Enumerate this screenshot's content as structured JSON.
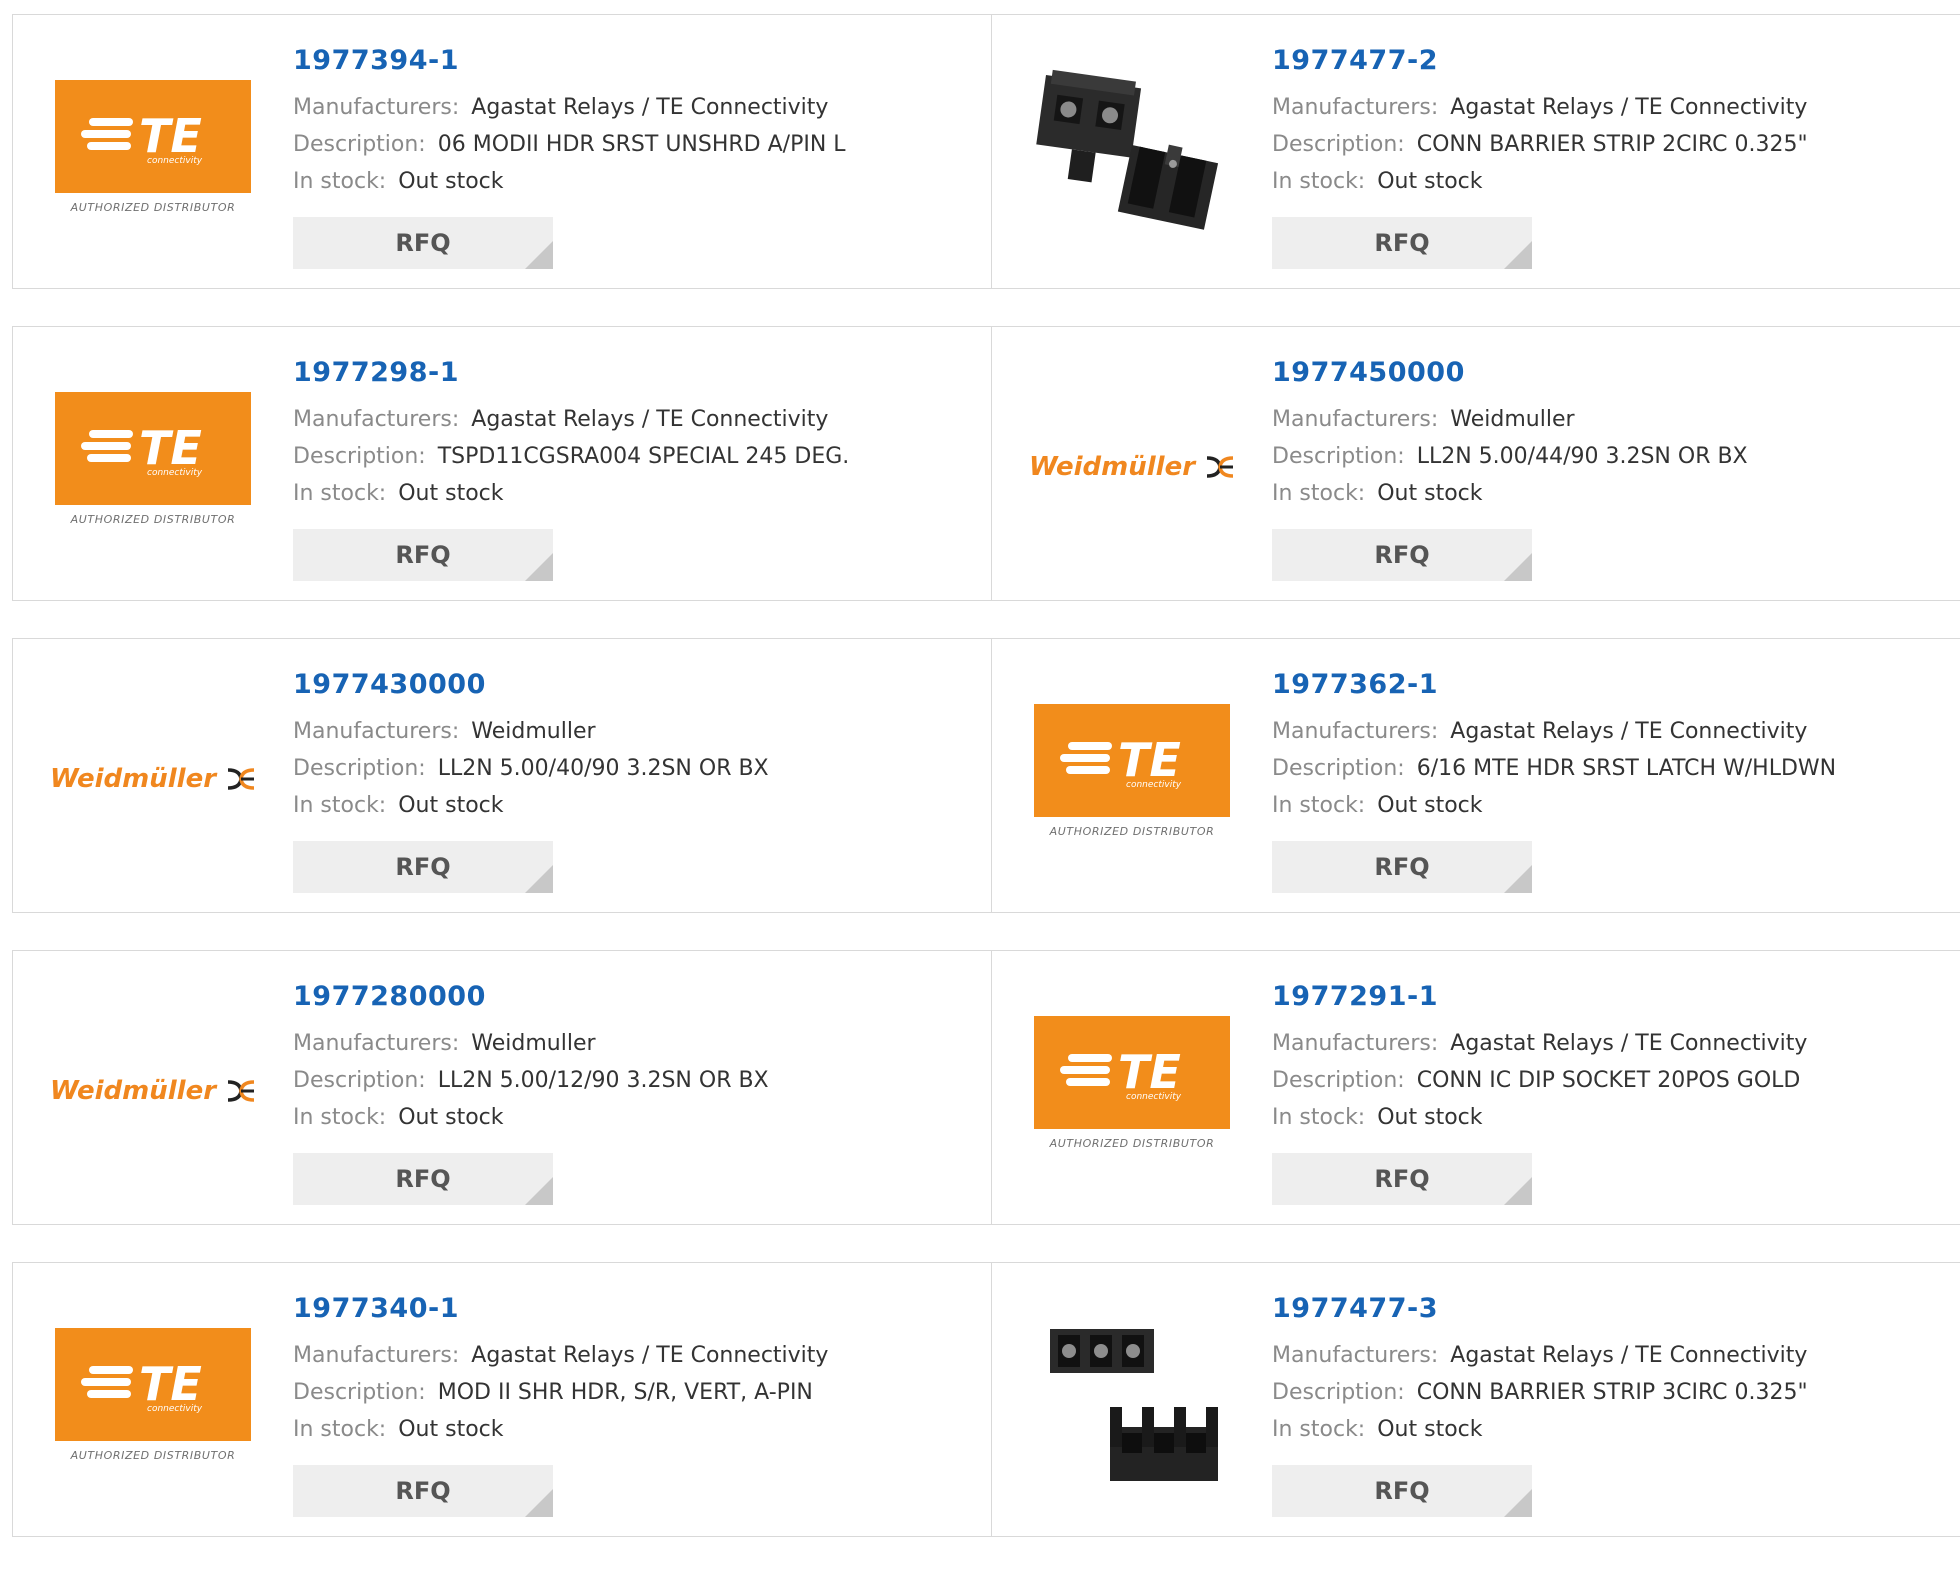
{
  "labels": {
    "manufacturers": "Manufacturers:",
    "description": "Description:",
    "in_stock": "In stock:",
    "rfq": "RFQ"
  },
  "logos": {
    "te_connectivity": "connectivity",
    "te_authorized": "AUTHORIZED DISTRIBUTOR",
    "weidmuller": "Weidmüller"
  },
  "colors": {
    "part_number": "#1763b4",
    "te_orange": "#f28d1b",
    "weidmuller_orange": "#f0871f"
  },
  "products": [
    {
      "part_number": "1977394-1",
      "manufacturer": "Agastat Relays / TE Connectivity",
      "description": "06 MODII HDR SRST UNSHRD A/PIN L",
      "stock": "Out stock",
      "image": "te-logo"
    },
    {
      "part_number": "1977477-2",
      "manufacturer": "Agastat Relays / TE Connectivity",
      "description": "CONN BARRIER STRIP 2CIRC 0.325\"",
      "stock": "Out stock",
      "image": "barrier-strip-2-photo"
    },
    {
      "part_number": "1977298-1",
      "manufacturer": "Agastat Relays / TE Connectivity",
      "description": "TSPD11CGSRA004 SPECIAL 245 DEG.",
      "stock": "Out stock",
      "image": "te-logo"
    },
    {
      "part_number": "1977450000",
      "manufacturer": "Weidmuller",
      "description": "LL2N 5.00/44/90 3.2SN OR BX",
      "stock": "Out stock",
      "image": "weidmuller-logo"
    },
    {
      "part_number": "1977430000",
      "manufacturer": "Weidmuller",
      "description": "LL2N 5.00/40/90 3.2SN OR BX",
      "stock": "Out stock",
      "image": "weidmuller-logo"
    },
    {
      "part_number": "1977362-1",
      "manufacturer": "Agastat Relays / TE Connectivity",
      "description": "6/16 MTE HDR SRST LATCH W/HLDWN",
      "stock": "Out stock",
      "image": "te-logo"
    },
    {
      "part_number": "1977280000",
      "manufacturer": "Weidmuller",
      "description": "LL2N 5.00/12/90 3.2SN OR BX",
      "stock": "Out stock",
      "image": "weidmuller-logo"
    },
    {
      "part_number": "1977291-1",
      "manufacturer": "Agastat Relays / TE Connectivity",
      "description": "CONN IC DIP SOCKET 20POS GOLD",
      "stock": "Out stock",
      "image": "te-logo"
    },
    {
      "part_number": "1977340-1",
      "manufacturer": "Agastat Relays / TE Connectivity",
      "description": "MOD II SHR HDR, S/R, VERT, A-PIN",
      "stock": "Out stock",
      "image": "te-logo"
    },
    {
      "part_number": "1977477-3",
      "manufacturer": "Agastat Relays / TE Connectivity",
      "description": "CONN BARRIER STRIP 3CIRC 0.325\"",
      "stock": "Out stock",
      "image": "barrier-strip-3-photo"
    }
  ]
}
